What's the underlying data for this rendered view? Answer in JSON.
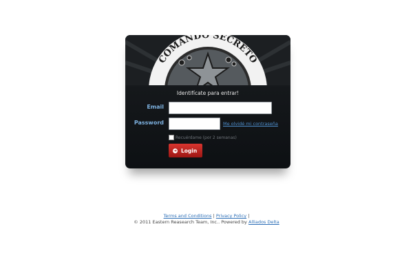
{
  "banner": {
    "title": "COMANDO SECRETO"
  },
  "login": {
    "subtitle": "Identifícate para entrar!",
    "email_label": "Email",
    "email_value": "",
    "password_label": "Password",
    "password_value": "",
    "forgot_link": "Me olvidé mi contraseña",
    "remember_label": "Recuérdame (por 2 semanas)",
    "remember_checked": false,
    "login_button": "Login"
  },
  "footer": {
    "terms": "Terms and Conditions",
    "separator1": "|",
    "privacy": "Privacy Policy",
    "separator2": "|",
    "copyright": "© 2011 Eastern Reasearch Team, Inc.. Powered by",
    "powered_link": "Alliados Delta"
  },
  "colors": {
    "label_blue": "#7db1e0",
    "link_blue": "#2a6db6",
    "button_red": "#c2211d"
  }
}
